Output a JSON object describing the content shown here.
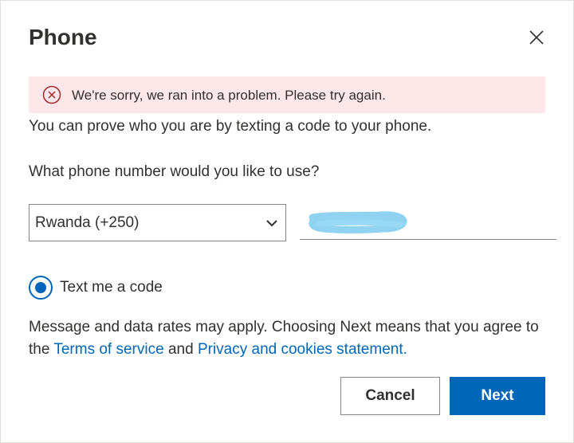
{
  "dialog": {
    "title": "Phone",
    "close_icon": "close-icon"
  },
  "error": {
    "icon": "error-circle-icon",
    "message": "We're sorry, we ran into a problem. Please try again.",
    "color": "#fde7e9",
    "icon_color": "#a4262c"
  },
  "intro_text": "You can prove who you are by texting a code to your phone.",
  "phone_question": "What phone number would you like to use?",
  "country_select": {
    "selected": "Rwanda (+250)",
    "icon": "chevron-down-icon"
  },
  "phone_number": {
    "value": ""
  },
  "method": {
    "label": "Text me a code",
    "checked": true
  },
  "disclaimer": {
    "prefix": "Message and data rates may apply. Choosing Next means that you agree to the ",
    "terms_link": "Terms of service",
    "conjunction": " and ",
    "privacy_link": "Privacy and cookies statement."
  },
  "buttons": {
    "cancel": "Cancel",
    "next": "Next"
  },
  "colors": {
    "accent": "#0067b8",
    "text": "#323130",
    "border": "#8a8886"
  }
}
